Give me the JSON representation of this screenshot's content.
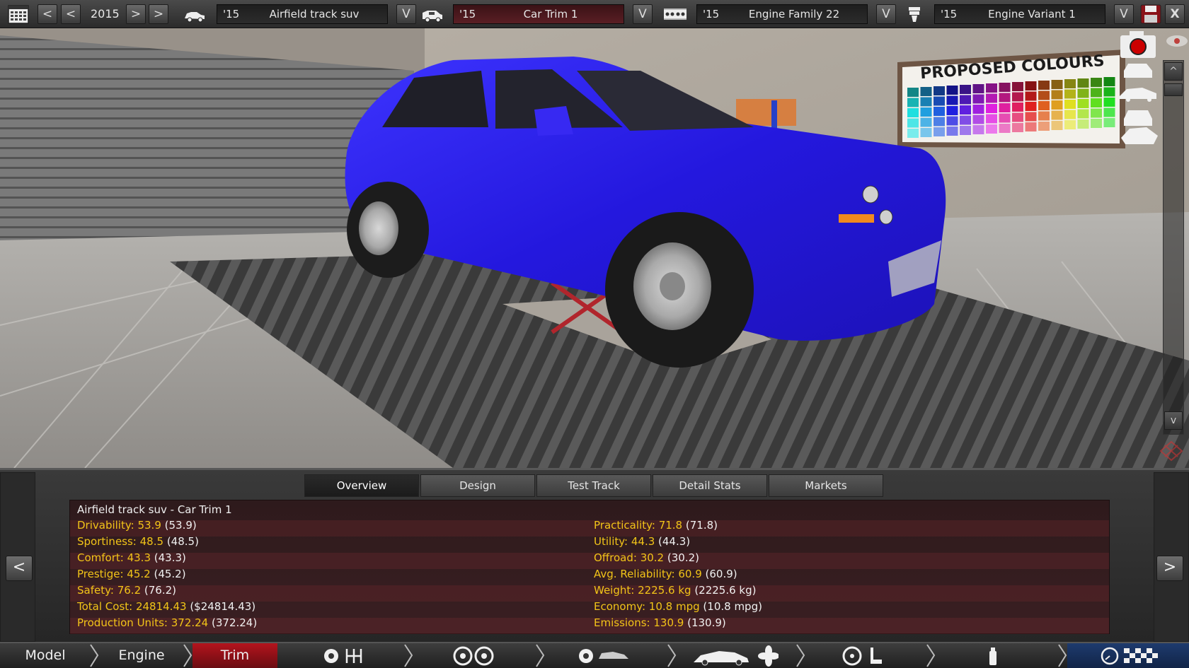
{
  "topbar": {
    "year": "2015",
    "model_combo": {
      "year": "'15",
      "name": "Airfield track suv"
    },
    "trim_combo": {
      "year": "'15",
      "name": "Car Trim 1"
    },
    "engine_combo": {
      "year": "'15",
      "name": "Engine Family 22"
    },
    "variant_combo": {
      "year": "'15",
      "name": "Engine Variant 1"
    },
    "prev_fast": "<",
    "prev": "<",
    "next": ">",
    "next_fast": ">",
    "dropdown": "V",
    "close": "X"
  },
  "viewport": {
    "poster_text": "PROPOSED COLOURS",
    "car_color": "#2a1ee8",
    "scroll_up": "^",
    "scroll_down": "v"
  },
  "tabs": [
    {
      "label": "Overview",
      "active": true
    },
    {
      "label": "Design",
      "active": false
    },
    {
      "label": "Test Track",
      "active": false
    },
    {
      "label": "Detail Stats",
      "active": false
    },
    {
      "label": "Markets",
      "active": false
    }
  ],
  "info": {
    "title": "Airfield track suv - Car Trim 1",
    "left": [
      {
        "key": "Drivability: 53.9",
        "val": "(53.9)"
      },
      {
        "key": "Sportiness: 48.5",
        "val": "(48.5)"
      },
      {
        "key": "Comfort: 43.3",
        "val": "(43.3)"
      },
      {
        "key": "Prestige: 45.2",
        "val": "(45.2)"
      },
      {
        "key": "Safety: 76.2",
        "val": "(76.2)"
      },
      {
        "key": "Total Cost: 24814.43",
        "val": "($24814.43)"
      },
      {
        "key": "Production Units: 372.24",
        "val": "(372.24)"
      }
    ],
    "right": [
      {
        "key": "Practicality: 71.8",
        "val": "(71.8)"
      },
      {
        "key": "Utility: 44.3",
        "val": "(44.3)"
      },
      {
        "key": "Offroad: 30.2",
        "val": "(30.2)"
      },
      {
        "key": "Avg. Reliability: 60.9",
        "val": "(60.9)"
      },
      {
        "key": "Weight: 2225.6 kg",
        "val": "(2225.6 kg)"
      },
      {
        "key": "Economy: 10.8 mpg",
        "val": "(10.8 mpg)"
      },
      {
        "key": "Emissions: 130.9",
        "val": "(130.9)"
      }
    ]
  },
  "panel_nav": {
    "prev": "<",
    "next": ">"
  },
  "bottombar": {
    "model": "Model",
    "engine": "Engine",
    "trim": "Trim",
    "accent": "#b3141d"
  }
}
